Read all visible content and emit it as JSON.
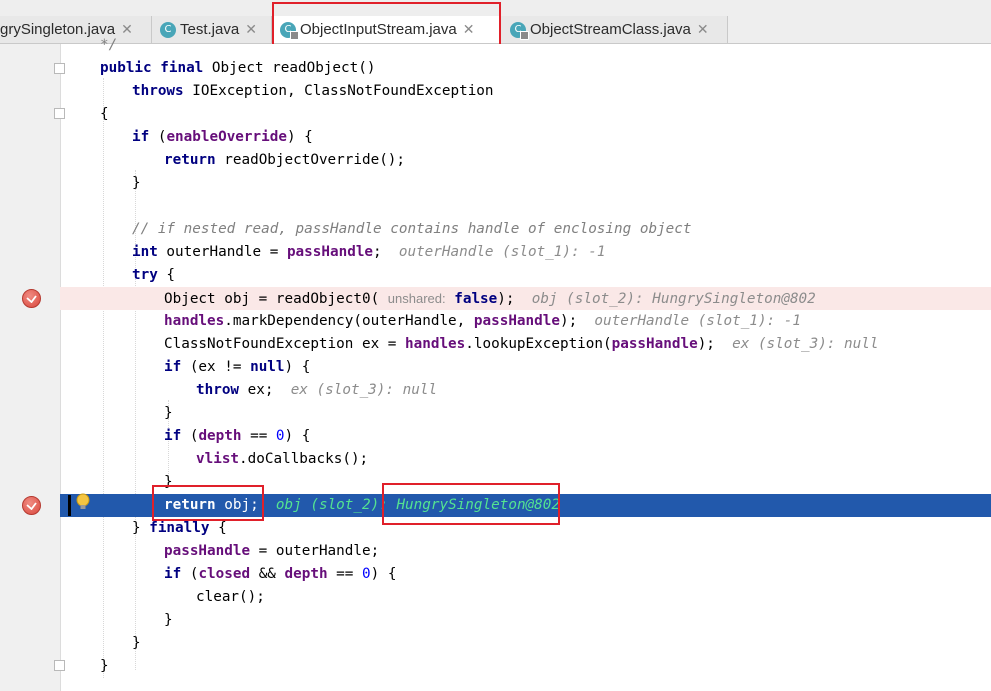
{
  "tabs": [
    {
      "label": "grySingleton.java",
      "active": false
    },
    {
      "label": "Test.java",
      "active": false
    },
    {
      "label": "ObjectInputStream.java",
      "active": true
    },
    {
      "label": "ObjectStreamClass.java",
      "active": false
    }
  ],
  "colors": {
    "keyword": "#000080",
    "field": "#660e7a",
    "number": "#0000ff",
    "comment": "#808080",
    "current_line": "#2259ac",
    "breakpoint_line": "#fae8e7",
    "highlight_box": "#e0202a"
  },
  "code": {
    "l0": "*/",
    "l1a": "public final",
    "l1b": " Object readObject()",
    "l2a": "throws",
    "l2b": " IOException, ClassNotFoundException",
    "l3": "{",
    "l4a": "if",
    "l4b": " (",
    "l4c": "enableOverride",
    "l4d": ") {",
    "l5a": "return",
    "l5b": " readObjectOverride();",
    "l6": "}",
    "l8": "// if nested read, passHandle contains handle of enclosing object",
    "l9a": "int",
    "l9b": " outerHandle = ",
    "l9c": "passHandle",
    "l9d": ";",
    "l9h": "outerHandle (slot_1): -1",
    "l10a": "try",
    "l10b": " {",
    "l11a": "Object obj = readObject0( ",
    "l11p": "unshared:",
    "l11b": " ",
    "l11c": "false",
    "l11d": ");",
    "l11h": "obj (slot_2): HungrySingleton@802",
    "l12a": "handles",
    "l12b": ".markDependency(outerHandle, ",
    "l12c": "passHandle",
    "l12d": ");",
    "l12h": "outerHandle (slot_1): -1",
    "l13a": "ClassNotFoundException ex = ",
    "l13b": "handles",
    "l13c": ".lookupException(",
    "l13d": "passHandle",
    "l13e": ");",
    "l13h": "ex (slot_3): null",
    "l14a": "if",
    "l14b": " (ex != ",
    "l14c": "null",
    "l14d": ") {",
    "l15a": "throw",
    "l15b": " ex;",
    "l15h": "ex (slot_3): null",
    "l16": "}",
    "l17a": "if",
    "l17b": " (",
    "l17c": "depth",
    "l17d": " == ",
    "l17e": "0",
    "l17f": ") {",
    "l18a": "vlist",
    "l18b": ".doCallbacks();",
    "l19": "}",
    "l20a": "return",
    "l20b": " obj;",
    "l20h1": "obj (slot_2): ",
    "l20h2": "HungrySingleton@802",
    "l21a": "} ",
    "l21b": "finally",
    "l21c": " {",
    "l22a": "passHandle",
    "l22b": " = outerHandle;",
    "l23a": "if",
    "l23b": " (",
    "l23c": "closed",
    "l23d": " && ",
    "l23e": "depth",
    "l23f": " == ",
    "l23g": "0",
    "l23h": ") {",
    "l24": "clear();",
    "l25": "}",
    "l26": "}",
    "l27": "}"
  }
}
